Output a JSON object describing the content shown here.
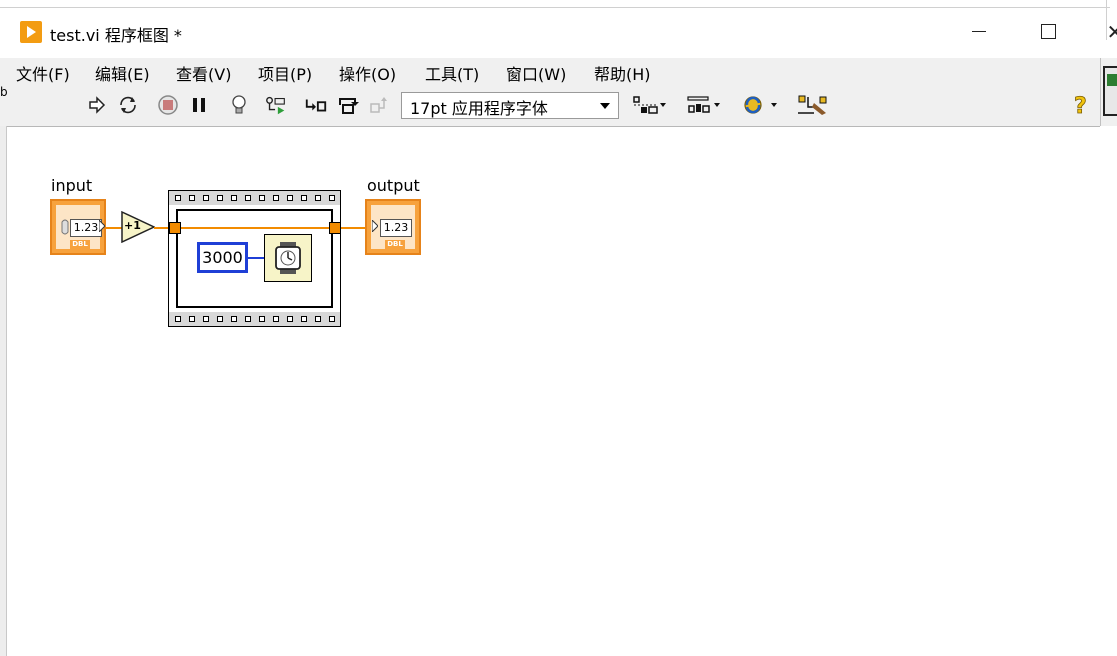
{
  "window": {
    "title": "test.vi 程序框图 *"
  },
  "menu": {
    "items": [
      "文件(F)",
      "编辑(E)",
      "查看(V)",
      "项目(P)",
      "操作(O)",
      "工具(T)",
      "窗口(W)",
      "帮助(H)"
    ]
  },
  "toolbar": {
    "font_select_value": "17pt 应用程序字体"
  },
  "diagram": {
    "input_label": "input",
    "output_label": "output",
    "input_display": "1.23",
    "output_display": "1.23",
    "input_type": "DBL",
    "output_type": "DBL",
    "increment_label": "+1",
    "constant_value": "3000"
  },
  "left_strip_text": "b"
}
